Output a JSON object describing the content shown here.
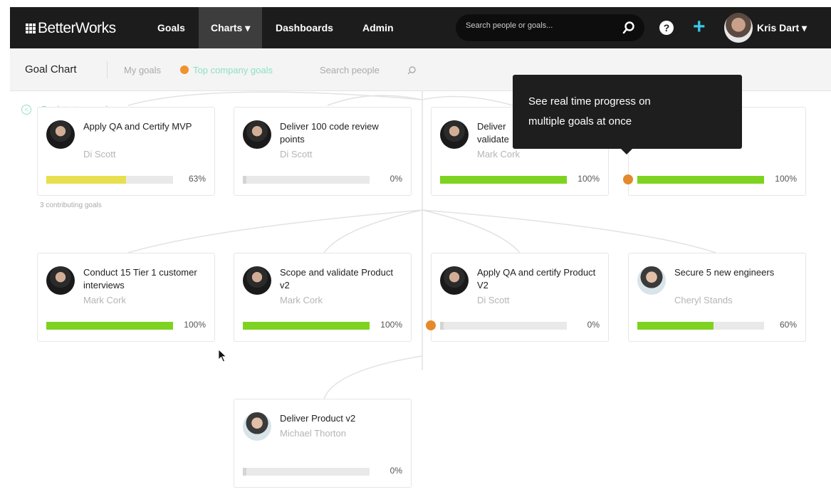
{
  "nav": {
    "logo": "BetterWorks",
    "items": [
      {
        "label": "Goals"
      },
      {
        "label": "Charts ▾"
      },
      {
        "label": "Dashboards"
      },
      {
        "label": "Admin"
      }
    ],
    "search_placeholder": "Search people or goals...",
    "user_name": "Kris Dart ▾"
  },
  "subheader": {
    "title": "Goal Chart",
    "my_goals": "My goals",
    "top_company_goals": "Top company goals",
    "search_people": "Search people"
  },
  "chart": {
    "back_link": "Back to top goals",
    "contributing": "3 contributing goals",
    "tooltip_line1": "See real time progress on",
    "tooltip_line2": "multiple goals at once",
    "row1": [
      {
        "title": "Apply QA and Certify MVP",
        "owner": "Di Scott",
        "pct_label": "63%",
        "progress": 0.63,
        "color": "#e8df4e"
      },
      {
        "title": "Deliver 100 code review points",
        "owner": "Di Scott",
        "pct_label": "0%",
        "progress": 0.0,
        "color": "#9ad64a"
      },
      {
        "title": "Deliver validate",
        "owner": "Mark Cork",
        "pct_label": "100%",
        "progress": 1.0,
        "color": "#7ed321"
      },
      {
        "title": "",
        "owner": "",
        "pct_label": "100%",
        "progress": 1.0,
        "color": "#7ed321"
      }
    ],
    "row2": [
      {
        "title": "Conduct 15 Tier 1 customer interviews",
        "owner": "Mark Cork",
        "pct_label": "100%",
        "progress": 1.0,
        "color": "#7ed321"
      },
      {
        "title": "Scope and validate Product v2",
        "owner": "Mark Cork",
        "pct_label": "100%",
        "progress": 1.0,
        "color": "#7ed321"
      },
      {
        "title": "Apply QA and certify Product V2",
        "owner": "Di Scott",
        "pct_label": "0%",
        "progress": 0.0,
        "color": "#7ed321"
      },
      {
        "title": "Secure 5 new engineers",
        "owner": "Cheryl Stands",
        "pct_label": "60%",
        "progress": 0.6,
        "color": "#7ed321"
      }
    ],
    "row3": [
      {
        "title": "Deliver Product v2",
        "owner": "Michael Thorton",
        "pct_label": "0%",
        "progress": 0.0,
        "color": "#7ed321"
      }
    ]
  }
}
